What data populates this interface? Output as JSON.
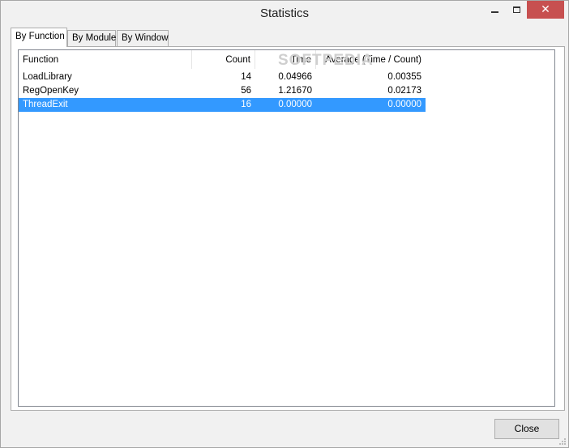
{
  "window": {
    "title": "Statistics"
  },
  "caption_buttons": {
    "minimize_icon": "minimize-icon",
    "maximize_icon": "maximize-icon",
    "close_glyph": "✕"
  },
  "tabs": [
    {
      "label": "By Function",
      "active": true
    },
    {
      "label": "By Module",
      "active": false
    },
    {
      "label": "By Window",
      "active": false
    }
  ],
  "table": {
    "columns": [
      "Function",
      "Count",
      "Time",
      "Average (Time / Count)"
    ],
    "rows": [
      {
        "function": "LoadLibrary",
        "count": "14",
        "time": "0.04966",
        "average": "0.00355",
        "selected": false
      },
      {
        "function": "RegOpenKey",
        "count": "56",
        "time": "1.21670",
        "average": "0.02173",
        "selected": false
      },
      {
        "function": "ThreadExit",
        "count": "16",
        "time": "0.00000",
        "average": "0.00000",
        "selected": true
      }
    ]
  },
  "watermark": "SOFTPEDIA",
  "footer": {
    "close_label": "Close"
  },
  "colors": {
    "selection": "#3399ff",
    "close_hover": "#c75050"
  }
}
